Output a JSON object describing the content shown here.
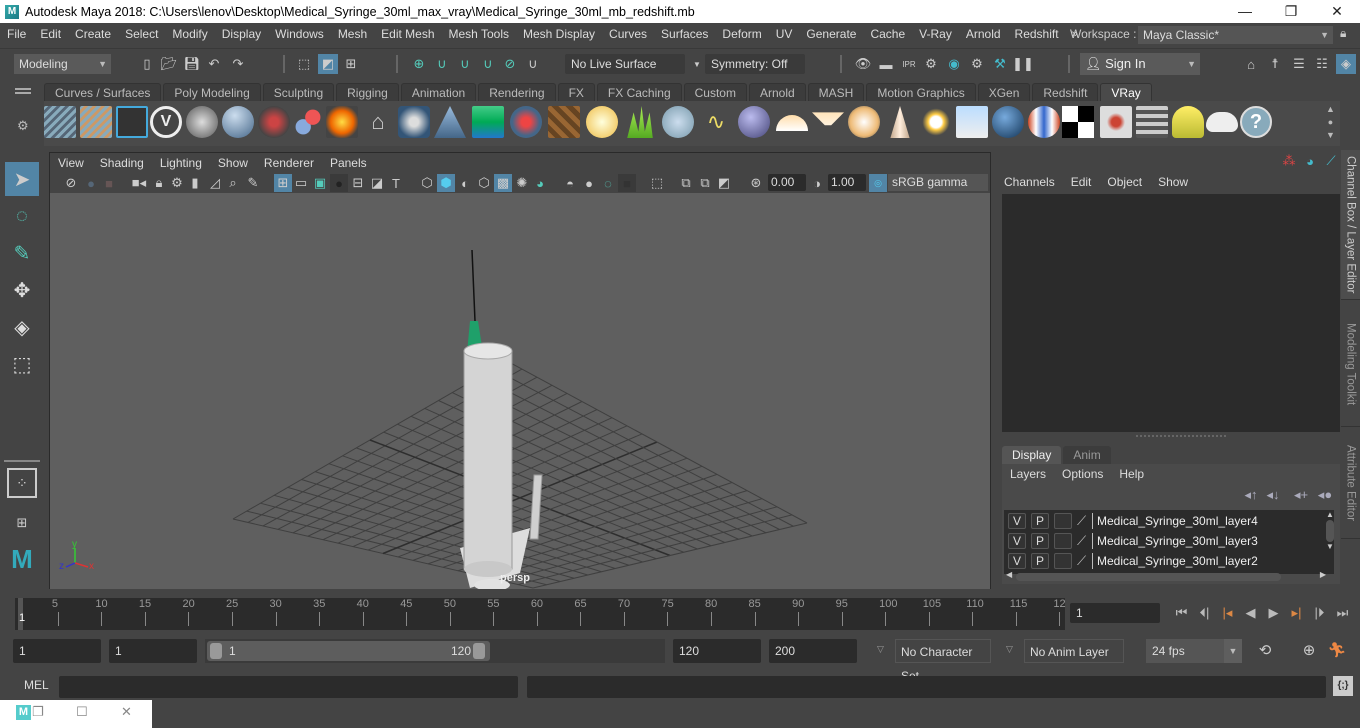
{
  "window": {
    "title": "Autodesk Maya 2018: C:\\Users\\lenov\\Desktop\\Medical_Syringe_30ml_max_vray\\Medical_Syringe_30ml_mb_redshift.mb",
    "logo": "M",
    "controls": {
      "minimize": "—",
      "maximize": "❐",
      "close": "✕"
    }
  },
  "menubar": {
    "items": [
      "File",
      "Edit",
      "Create",
      "Select",
      "Modify",
      "Display",
      "Windows",
      "Mesh",
      "Edit Mesh",
      "Mesh Tools",
      "Mesh Display",
      "Curves",
      "Surfaces",
      "Deform",
      "UV",
      "Generate",
      "Cache",
      "V-Ray",
      "Arnold",
      "Redshift"
    ],
    "overflow": "»",
    "workspace_label": "Workspace :",
    "workspace_value": "Maya Classic*"
  },
  "statusline": {
    "mode": "Modeling",
    "live_surface": "No Live Surface",
    "symmetry": "Symmetry: Off",
    "sign_in": "Sign In"
  },
  "shelf": {
    "tabs": [
      "Curves / Surfaces",
      "Poly Modeling",
      "Sculpting",
      "Rigging",
      "Animation",
      "Rendering",
      "FX",
      "FX Caching",
      "Custom",
      "Arnold",
      "MASH",
      "Motion Graphics",
      "XGen",
      "Redshift",
      "VRay"
    ],
    "active_tab": "VRay"
  },
  "viewport": {
    "menu": [
      "View",
      "Shading",
      "Lighting",
      "Show",
      "Renderer",
      "Panels"
    ],
    "exposure": "0.00",
    "gamma": "1.00",
    "color_space": "sRGB gamma",
    "camera_label": "persp",
    "axis": {
      "x": "x",
      "y": "y",
      "z": "z"
    }
  },
  "channel_box": {
    "menu": [
      "Channels",
      "Edit",
      "Object",
      "Show"
    ]
  },
  "layer_editor": {
    "tabs": [
      "Display",
      "Anim"
    ],
    "active_tab": "Display",
    "menu": [
      "Layers",
      "Options",
      "Help"
    ],
    "layers": [
      {
        "v": "V",
        "p": "P",
        "name": "Medical_Syringe_30ml_layer4"
      },
      {
        "v": "V",
        "p": "P",
        "name": "Medical_Syringe_30ml_layer3"
      },
      {
        "v": "V",
        "p": "P",
        "name": "Medical_Syringe_30ml_layer2"
      }
    ]
  },
  "side_tabs": [
    "Channel Box / Layer Editor",
    "Modeling Toolkit",
    "Attribute Editor"
  ],
  "timeline": {
    "ticks": [
      "5",
      "10",
      "15",
      "20",
      "25",
      "30",
      "35",
      "40",
      "45",
      "50",
      "55",
      "60",
      "65",
      "70",
      "75",
      "80",
      "85",
      "90",
      "95",
      "100",
      "105",
      "110",
      "115",
      "12"
    ],
    "current_frame_marker": "1",
    "current_frame": "1"
  },
  "range": {
    "start": "1",
    "playback_start": "1",
    "slider_start": "1",
    "slider_end": "120",
    "playback_end": "120",
    "end": "200",
    "character_set": "No Character Set",
    "anim_layer": "No Anim Layer",
    "fps": "24 fps"
  },
  "cmdline": {
    "label": "MEL",
    "input": ""
  }
}
